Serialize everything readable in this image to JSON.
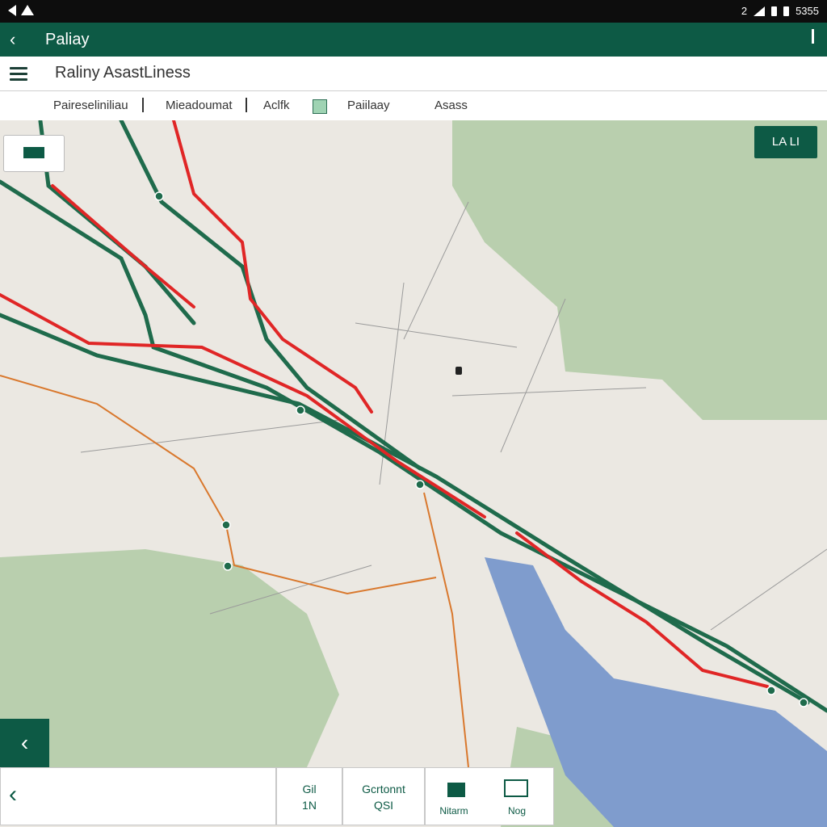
{
  "status": {
    "time": "5355",
    "sim": "2"
  },
  "appbar": {
    "title": "Paliay"
  },
  "header": {
    "title": "Raliny AsastLiness"
  },
  "filters": {
    "items": [
      {
        "label": "Paireseliniliau"
      },
      {
        "label": "Mieadoumat"
      },
      {
        "label": "Aclfk"
      },
      {
        "label": "Paiilaay"
      },
      {
        "label": "Asass"
      }
    ]
  },
  "map": {
    "layer_chip": "LA LI",
    "colors": {
      "land": "#ebe8e2",
      "forest": "#b9cfae",
      "water": "#7f9ccd",
      "rail_green": "#1f6b4c",
      "rail_red": "#e02626",
      "road_orange": "#d9782d"
    }
  },
  "bottom": {
    "btn1": {
      "line1": "Gil",
      "line2": "1N"
    },
    "btn2": {
      "line1": "Gcrtonnt",
      "line2": "QSI"
    },
    "btn3": {
      "label_a": "Nitarm",
      "label_b": "Nog"
    }
  }
}
